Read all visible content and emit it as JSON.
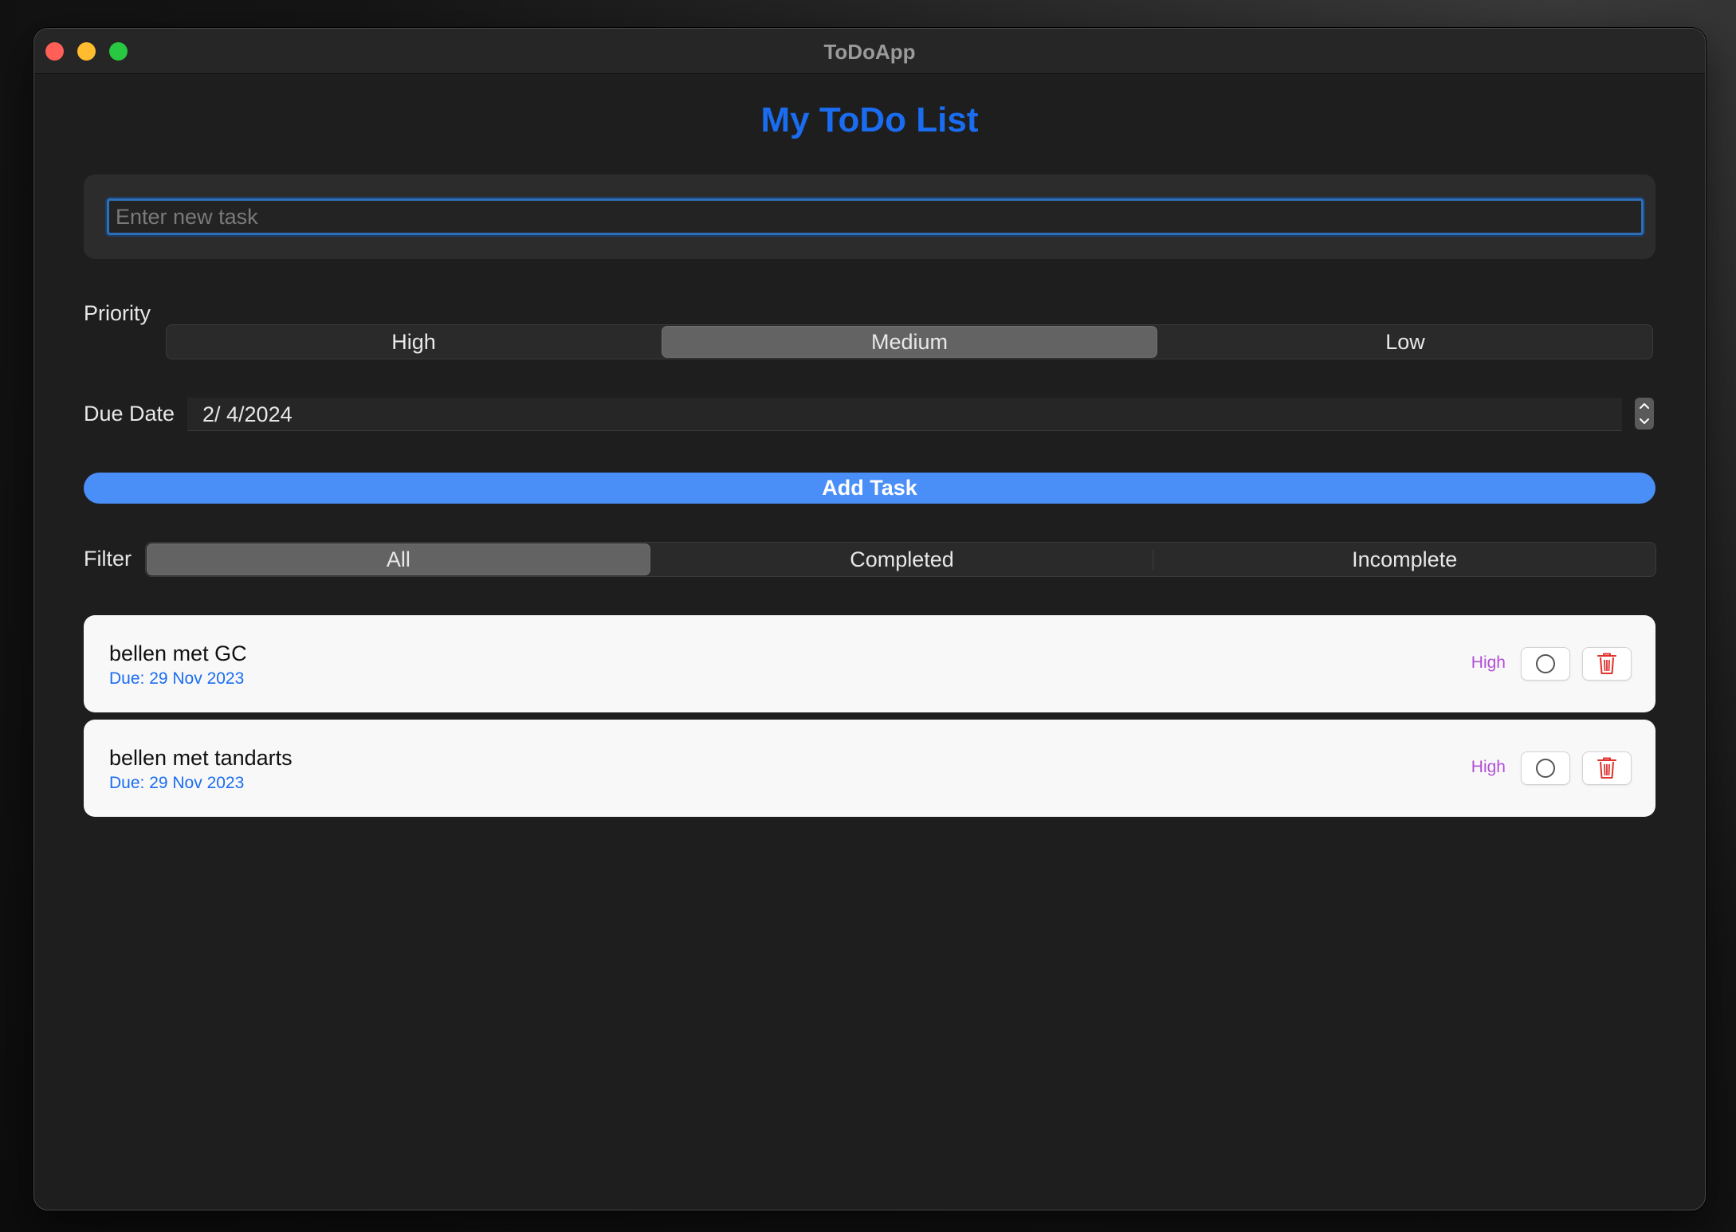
{
  "window": {
    "title": "ToDoApp"
  },
  "header": {
    "title": "My ToDo List",
    "accent_color": "#1a6cf0"
  },
  "new_task": {
    "value": "",
    "placeholder": "Enter new task"
  },
  "priority": {
    "label": "Priority",
    "options": [
      "High",
      "Medium",
      "Low"
    ],
    "selected": "Medium"
  },
  "due_date": {
    "label": "Due Date",
    "value": "2/ 4/2024"
  },
  "add_button": {
    "label": "Add Task",
    "color": "#4a8ff7"
  },
  "filter": {
    "label": "Filter",
    "options": [
      "All",
      "Completed",
      "Incomplete"
    ],
    "selected": "All"
  },
  "tasks": [
    {
      "title": "bellen met GC",
      "due": "Due: 29 Nov 2023",
      "priority": "High",
      "completed": false,
      "toggle_icon": "circle-outline-icon",
      "delete_icon": "trash-icon"
    },
    {
      "title": "bellen met tandarts",
      "due": "Due: 29 Nov 2023",
      "priority": "High",
      "completed": false,
      "toggle_icon": "circle-outline-icon",
      "delete_icon": "trash-icon"
    }
  ],
  "colors": {
    "priority_high": "#b24fd6",
    "delete": "#e0312c"
  }
}
